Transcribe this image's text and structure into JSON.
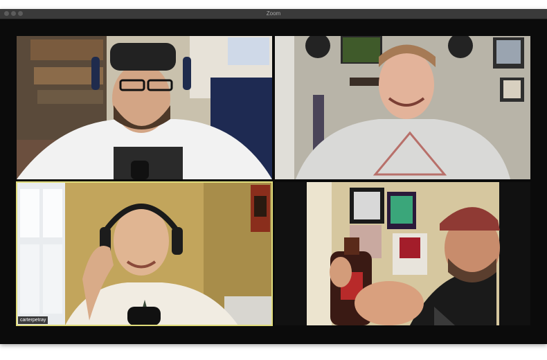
{
  "window": {
    "title": "Zoom"
  },
  "participants": [
    {
      "name": "",
      "icon": "video-feed"
    },
    {
      "name": "",
      "icon": "video-feed"
    },
    {
      "name": "carterpetray",
      "icon": "video-feed",
      "active_speaker": true
    },
    {
      "name": "",
      "icon": "video-feed"
    }
  ],
  "colors": {
    "active_border": "#e0dc7a",
    "window_bg": "#0b0b0b",
    "titlebar": "#3a3a3a"
  }
}
